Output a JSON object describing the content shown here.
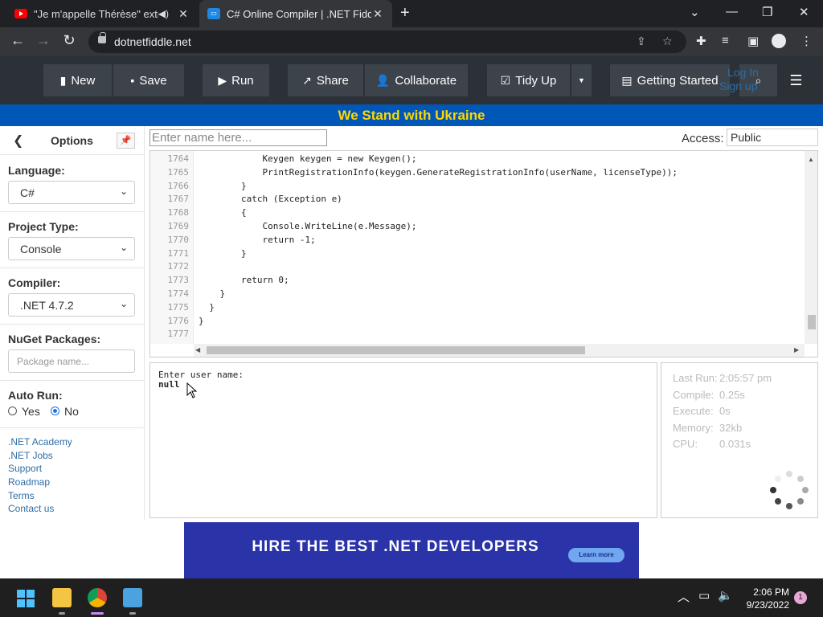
{
  "browser": {
    "tabs": [
      {
        "title": "\"Je m'appelle Thérèse\" extrai",
        "active": false
      },
      {
        "title": "C# Online Compiler | .NET Fiddle",
        "active": true
      }
    ],
    "url": "dotnetfiddle.net"
  },
  "header": {
    "buttons": {
      "new": "New",
      "save": "Save",
      "run": "Run",
      "share": "Share",
      "collaborate": "Collaborate",
      "tidy_up": "Tidy Up",
      "getting_started": "Getting Started"
    },
    "login": "Log In",
    "signup": "Sign up"
  },
  "banner": {
    "text": "We Stand with Ukraine",
    "bg_color": "#0057b8",
    "text_color": "#ffd700"
  },
  "sidebar": {
    "title": "Options",
    "language_label": "Language:",
    "language_value": "C#",
    "project_type_label": "Project Type:",
    "project_type_value": "Console",
    "compiler_label": "Compiler:",
    "compiler_value": ".NET 4.7.2",
    "nuget_label": "NuGet Packages:",
    "nuget_placeholder": "Package name...",
    "auto_run_label": "Auto Run:",
    "auto_run_yes": "Yes",
    "auto_run_no": "No",
    "auto_run_selected": "No",
    "links": [
      ".NET Academy",
      ".NET Jobs",
      "Support",
      "Roadmap",
      "Terms",
      "Contact us"
    ]
  },
  "main": {
    "name_placeholder": "Enter name here...",
    "access_label": "Access:",
    "access_value": "Public"
  },
  "editor": {
    "lines": [
      {
        "n": "1764",
        "code": "            Keygen keygen = new Keygen();"
      },
      {
        "n": "1765",
        "code": "            PrintRegistrationInfo(keygen.GenerateRegistrationInfo(userName, licenseType));"
      },
      {
        "n": "1766",
        "code": "        }"
      },
      {
        "n": "1767",
        "code": "        catch (Exception e)"
      },
      {
        "n": "1768",
        "code": "        {"
      },
      {
        "n": "1769",
        "code": "            Console.WriteLine(e.Message);"
      },
      {
        "n": "1770",
        "code": "            return -1;"
      },
      {
        "n": "1771",
        "code": "        }"
      },
      {
        "n": "1772",
        "code": ""
      },
      {
        "n": "1773",
        "code": "        return 0;"
      },
      {
        "n": "1774",
        "code": "    }"
      },
      {
        "n": "1775",
        "code": "  }"
      },
      {
        "n": "1776",
        "code": "}"
      },
      {
        "n": "1777",
        "code": ""
      }
    ]
  },
  "output": {
    "lines": [
      "Enter user name:",
      "null"
    ]
  },
  "stats": {
    "last_run_label": "Last Run:",
    "last_run_value": "2:05:57 pm",
    "compile_label": "Compile:",
    "compile_value": "0.25s",
    "execute_label": "Execute:",
    "execute_value": "0s",
    "memory_label": "Memory:",
    "memory_value": "32kb",
    "cpu_label": "CPU:",
    "cpu_value": "0.031s"
  },
  "ad": {
    "text": "HIRE THE BEST .NET DEVELOPERS",
    "button": "Learn more"
  },
  "taskbar": {
    "time": "2:06 PM",
    "date": "9/23/2022",
    "notification_count": "1"
  }
}
